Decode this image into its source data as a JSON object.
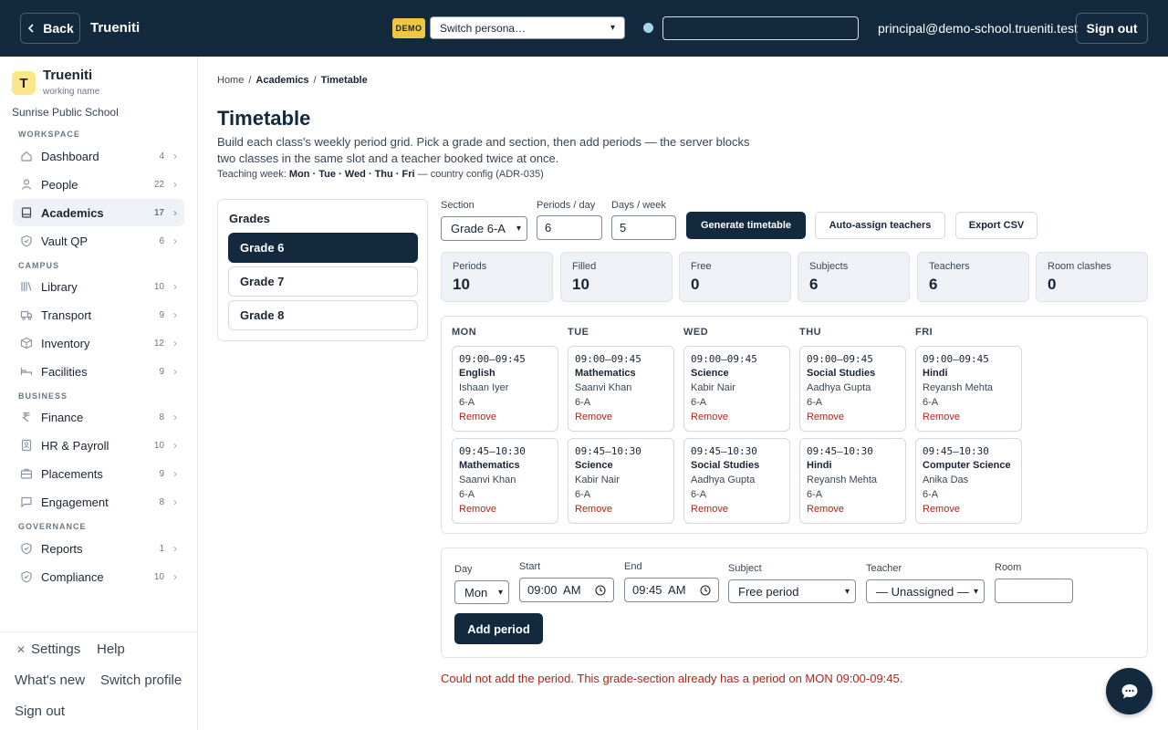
{
  "topbar": {
    "back_label": "Back",
    "brand": "Trueniti",
    "demo_badge": "DEMO",
    "persona_select": "Switch persona…",
    "search_value": "",
    "user_email": "principal@demo-school.trueniti.test",
    "signout_label": "Sign out",
    "status_dot_color": "#a8d3ea"
  },
  "sidebar": {
    "logo_letter": "T",
    "org_name": "Trueniti",
    "org_sub": "working name",
    "school_name": "Sunrise Public School",
    "sections": {
      "workspace": "WORKSPACE",
      "campus": "CAMPUS",
      "business": "BUSINESS",
      "governance": "GOVERNANCE"
    },
    "items": [
      {
        "label": "Dashboard",
        "count": "4",
        "icon": "home-icon"
      },
      {
        "label": "People",
        "count": "22",
        "icon": "user-icon"
      },
      {
        "label": "Academics",
        "count": "17",
        "icon": "book-icon",
        "active": true
      },
      {
        "label": "Vault QP",
        "count": "6",
        "icon": "shield-icon"
      },
      {
        "label": "Library",
        "count": "10",
        "icon": "library-icon"
      },
      {
        "label": "Transport",
        "count": "9",
        "icon": "truck-icon"
      },
      {
        "label": "Inventory",
        "count": "12",
        "icon": "box-icon"
      },
      {
        "label": "Facilities",
        "count": "9",
        "icon": "bed-icon"
      },
      {
        "label": "Finance",
        "count": "8",
        "icon": "rupee-icon"
      },
      {
        "label": "HR & Payroll",
        "count": "10",
        "icon": "id-badge-icon"
      },
      {
        "label": "Placements",
        "count": "9",
        "icon": "briefcase-icon"
      },
      {
        "label": "Engagement",
        "count": "8",
        "icon": "chat-icon"
      },
      {
        "label": "Reports",
        "count": "1",
        "icon": "shield-icon"
      },
      {
        "label": "Compliance",
        "count": "10",
        "icon": "shield-icon"
      }
    ],
    "footer": {
      "settings": "Settings",
      "help": "Help",
      "whats_new": "What's new",
      "switch_profile": "Switch profile",
      "sign_out": "Sign out"
    }
  },
  "main": {
    "breadcrumb": [
      "Home",
      "Academics",
      "Timetable"
    ],
    "title": "Timetable",
    "description": "Build each class's weekly period grid. Pick a grade and section, then add periods — the server blocks two classes in the same slot and a teacher booked twice at once.",
    "teaching_week_prefix": "Teaching week:",
    "teaching_week_days": "Mon · Tue · Wed · Thu · Fri",
    "teaching_week_suffix": "— country config (ADR-035)",
    "grades_title": "Grades",
    "grades": [
      "Grade 6",
      "Grade 7",
      "Grade 8"
    ],
    "active_grade": "Grade 6",
    "controls": {
      "section_label": "Section",
      "section_value": "Grade 6-A",
      "periods_label": "Periods / day",
      "periods_value": "6",
      "days_label": "Days / week",
      "days_value": "5",
      "generate_label": "Generate timetable",
      "auto_assign_label": "Auto-assign teachers",
      "export_label": "Export CSV"
    },
    "stats": [
      {
        "label": "Periods",
        "value": "10"
      },
      {
        "label": "Filled",
        "value": "10"
      },
      {
        "label": "Free",
        "value": "0"
      },
      {
        "label": "Subjects",
        "value": "6"
      },
      {
        "label": "Teachers",
        "value": "6"
      },
      {
        "label": "Room clashes",
        "value": "0"
      }
    ],
    "days": [
      "MON",
      "TUE",
      "WED",
      "THU",
      "FRI"
    ],
    "remove_label": "Remove",
    "periods": [
      [
        {
          "time": "09:00–09:45",
          "subject": "English",
          "teacher": "Ishaan Iyer",
          "section": "6-A"
        },
        {
          "time": "09:45–10:30",
          "subject": "Mathematics",
          "teacher": "Saanvi Khan",
          "section": "6-A"
        }
      ],
      [
        {
          "time": "09:00–09:45",
          "subject": "Mathematics",
          "teacher": "Saanvi Khan",
          "section": "6-A"
        },
        {
          "time": "09:45–10:30",
          "subject": "Science",
          "teacher": "Kabir Nair",
          "section": "6-A"
        }
      ],
      [
        {
          "time": "09:00–09:45",
          "subject": "Science",
          "teacher": "Kabir Nair",
          "section": "6-A"
        },
        {
          "time": "09:45–10:30",
          "subject": "Social Studies",
          "teacher": "Aadhya Gupta",
          "section": "6-A"
        }
      ],
      [
        {
          "time": "09:00–09:45",
          "subject": "Social Studies",
          "teacher": "Aadhya Gupta",
          "section": "6-A"
        },
        {
          "time": "09:45–10:30",
          "subject": "Hindi",
          "teacher": "Reyansh Mehta",
          "section": "6-A"
        }
      ],
      [
        {
          "time": "09:00–09:45",
          "subject": "Hindi",
          "teacher": "Reyansh Mehta",
          "section": "6-A"
        },
        {
          "time": "09:45–10:30",
          "subject": "Computer Science",
          "teacher": "Anika Das",
          "section": "6-A"
        }
      ]
    ],
    "form": {
      "day_label": "Day",
      "day_value": "Mon",
      "start_label": "Start",
      "start_value": "09:00  AM",
      "end_label": "End",
      "end_value": "09:45  AM",
      "subject_label": "Subject",
      "subject_value": "Free period",
      "teacher_label": "Teacher",
      "teacher_value": "— Unassigned —",
      "room_label": "Room",
      "room_value": "",
      "add_label": "Add period"
    },
    "error": "Could not add the period. This grade-section already has a period on MON 09:00-09:45."
  },
  "colors": {
    "primary": "#13293d",
    "error": "#b42318",
    "demo_badge": "#f0c53f",
    "logo_bg": "#fde68a"
  }
}
